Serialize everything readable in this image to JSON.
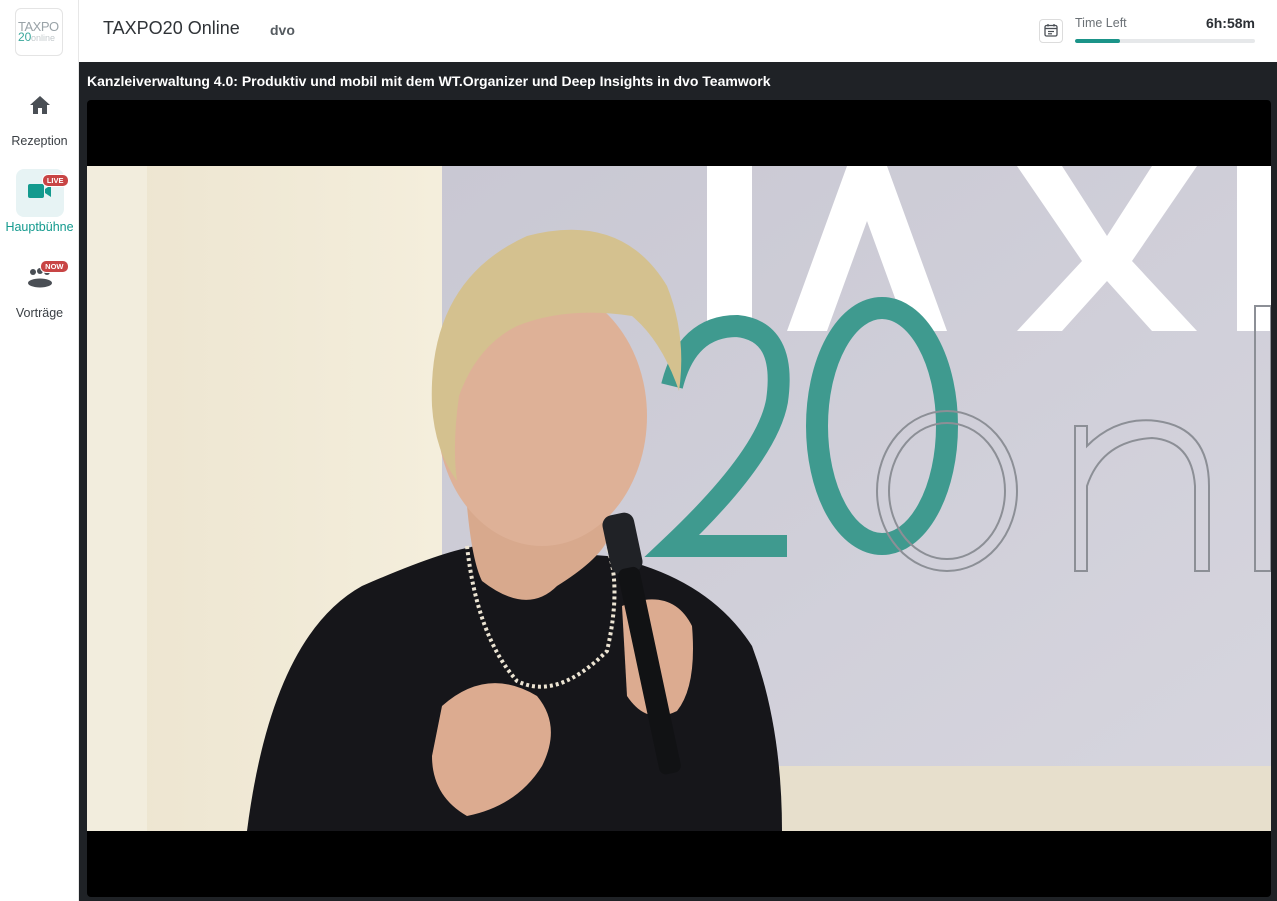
{
  "sidebar": {
    "logo": {
      "line1": "TAXPO",
      "line2": "20",
      "line3": "online"
    },
    "items": [
      {
        "label": "Rezeption",
        "icon": "home-icon",
        "active": false,
        "badge": ""
      },
      {
        "label": "Hauptbühne",
        "icon": "video-camera-icon",
        "active": true,
        "badge": "LIVE"
      },
      {
        "label": "Vorträge",
        "icon": "audience-icon",
        "active": false,
        "badge": "NOW"
      }
    ]
  },
  "header": {
    "title": "TAXPO20 Online",
    "organization": "dvo",
    "time_left_label": "Time Left",
    "time_left_value": "6h:58m",
    "time_progress_percent": 25
  },
  "stage": {
    "session_title": "Kanzleiverwaltung 4.0: Produktiv und mobil mit dem WT.Organizer und Deep Insights in dvo Teamwork"
  },
  "colors": {
    "accent": "#139a8e",
    "badge": "#c84545",
    "stage_bg": "#1f2226"
  }
}
